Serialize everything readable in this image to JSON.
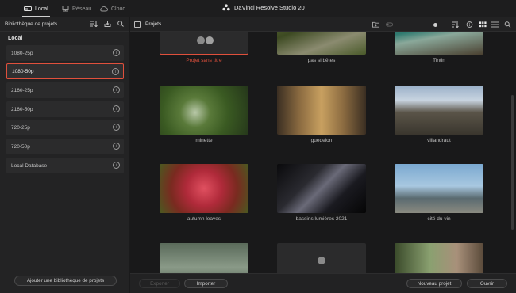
{
  "titlebar": {
    "tabs": [
      {
        "label": "Local",
        "icon": "drive-icon",
        "active": true
      },
      {
        "label": "Réseau",
        "icon": "network-icon",
        "active": false
      },
      {
        "label": "Cloud",
        "icon": "cloud-icon",
        "active": false
      }
    ],
    "app_title": "DaVinci Resolve Studio 20"
  },
  "sidebar": {
    "header": "Bibliothèque de projets",
    "section": "Local",
    "items": [
      {
        "label": "1080-25p",
        "selected": false
      },
      {
        "label": "1080-50p",
        "selected": true
      },
      {
        "label": "2160-25p",
        "selected": false
      },
      {
        "label": "2160-50p",
        "selected": false
      },
      {
        "label": "720-25p",
        "selected": false
      },
      {
        "label": "720-50p",
        "selected": false
      },
      {
        "label": "Local Database",
        "selected": false
      }
    ],
    "add_button": "Ajouter une bibliothèque de projets"
  },
  "main": {
    "header": "Projets",
    "projects": [
      {
        "name": "Projet sans titre",
        "selected": true
      },
      {
        "name": "pas si bêtes"
      },
      {
        "name": "Tintin"
      },
      {
        "name": "minette"
      },
      {
        "name": "guedelon"
      },
      {
        "name": "villandraut"
      },
      {
        "name": "autumn leaves"
      },
      {
        "name": "bassins lumières 2021"
      },
      {
        "name": "cité du vin"
      },
      {
        "name": ""
      },
      {
        "name": ""
      },
      {
        "name": ""
      }
    ]
  },
  "footer": {
    "export": "Exporter",
    "import": "Importer",
    "new_project": "Nouveau projet",
    "open": "Ouvrir"
  },
  "colors": {
    "accent": "#e0503c"
  }
}
